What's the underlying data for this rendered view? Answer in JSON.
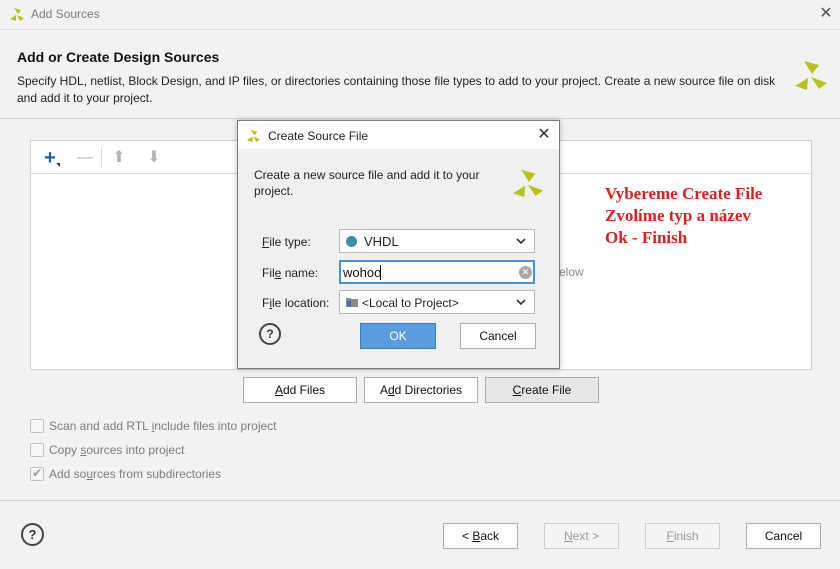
{
  "window": {
    "title": "Add Sources",
    "close_glyph": "✕"
  },
  "page": {
    "heading": "Add or Create Design Sources",
    "description": "Specify HDL, netlist, Block Design, and IP files, or directories containing those file types to add to your project. Create a new source file on disk and add it to your project."
  },
  "toolbar": {
    "add_glyph": "+",
    "remove_glyph": "—",
    "up_glyph": "⬆",
    "down_glyph": "⬇"
  },
  "panel": {
    "hint_fragment": "elow"
  },
  "buttons": {
    "add_files": {
      "pre": "",
      "key": "A",
      "post": "dd Files"
    },
    "add_directories": {
      "pre": "A",
      "key": "d",
      "post": "d Directories"
    },
    "create_file": {
      "pre": "",
      "key": "C",
      "post": "reate File"
    }
  },
  "options": {
    "scan_rtl": {
      "pre": "Scan and add RTL ",
      "key": "i",
      "post": "nclude files into project",
      "checked": false
    },
    "copy_sources": {
      "pre": "Copy ",
      "key": "s",
      "post": "ources into project",
      "checked": false
    },
    "add_subdirs": {
      "pre": "Add so",
      "key": "u",
      "post": "rces from subdirectories",
      "checked": true
    }
  },
  "footer": {
    "help_glyph": "?",
    "back": {
      "pre": "< ",
      "key": "B",
      "post": "ack"
    },
    "next": {
      "pre": "",
      "key": "N",
      "post": "ext >"
    },
    "finish": {
      "pre": "",
      "key": "F",
      "post": "inish"
    },
    "cancel": "Cancel"
  },
  "annotation": {
    "line1": "Vybereme Create File",
    "line2": "Zvolíme typ a název",
    "line3": "Ok - Finish"
  },
  "dialog": {
    "title": "Create Source File",
    "close_glyph": "✕",
    "description": "Create a new source file and add it to your project.",
    "file_type": {
      "label_key": "F",
      "label_rest": "ile type:",
      "value": "VHDL",
      "dot_color": "#3f8fa8"
    },
    "file_name": {
      "label_pre": "Fil",
      "label_key": "e",
      "label_rest": " name:",
      "value": "wohoo"
    },
    "file_location": {
      "label_pre": "F",
      "label_key": "i",
      "label_rest": "le location:",
      "value": "<Local to Project>"
    },
    "help_glyph": "?",
    "ok": "OK",
    "cancel": "Cancel",
    "dropdown_glyph": "⌄",
    "clear_glyph": "✕"
  },
  "colors": {
    "accent": "#5b9bdf",
    "annotation": "#e02020",
    "logo": "#b9c21d"
  }
}
